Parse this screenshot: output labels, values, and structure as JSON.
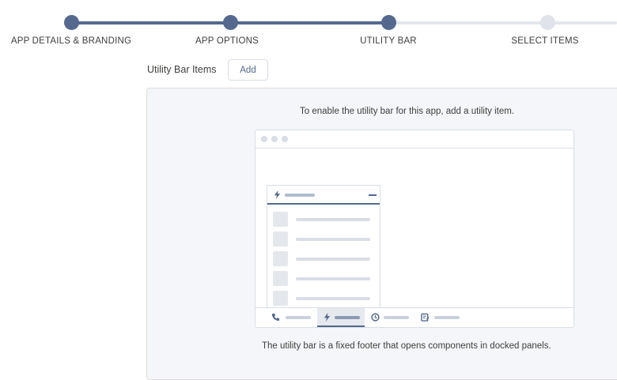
{
  "stepper": {
    "steps": [
      {
        "label": "APP DETAILS & BRANDING",
        "status": "complete"
      },
      {
        "label": "APP OPTIONS",
        "status": "complete"
      },
      {
        "label": "UTILITY BAR",
        "status": "current"
      },
      {
        "label": "SELECT ITEMS",
        "status": "upcoming"
      }
    ],
    "complete_color": "#54698d",
    "upcoming_color": "#e0e3ea"
  },
  "utility_items": {
    "label": "Utility Bar Items",
    "add_label": "Add"
  },
  "empty_state": {
    "message": "To enable the utility bar for this app, add a utility item.",
    "footer_message": "The utility bar is a fixed footer that opens components in docked panels."
  },
  "illustration": {
    "utility_bar_icons": [
      "phone-icon",
      "lightning-icon",
      "clock-icon",
      "note-icon"
    ],
    "active_item": "lightning-icon"
  }
}
